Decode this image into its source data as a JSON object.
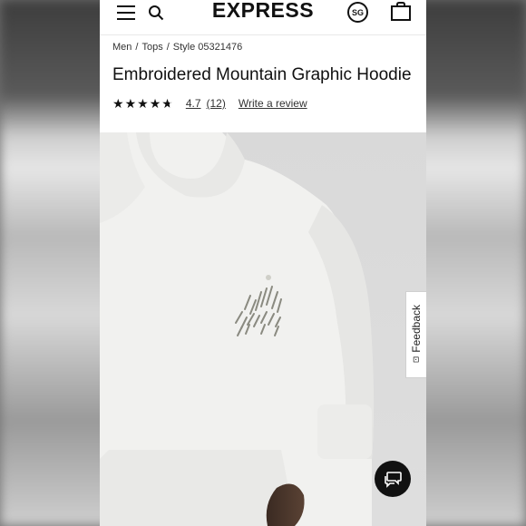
{
  "header": {
    "logo_text": "EXPRESS",
    "menu_icon": "hamburger-menu-icon",
    "search_icon": "search-icon",
    "region_badge": "SG",
    "bag_icon": "shopping-bag-icon"
  },
  "breadcrumb": {
    "items": [
      "Men",
      "Tops",
      "Style 05321476"
    ],
    "separator": "/"
  },
  "product": {
    "title": "Embroidered Mountain Graphic Hoodie",
    "rating": "4.7",
    "review_count": "(12)",
    "write_review_label": "Write a review",
    "stars": 4.7
  },
  "image": {
    "subject": "white hoodie with embroidered mountain graphic"
  },
  "feedback": {
    "label": "Feedback"
  },
  "chat": {
    "icon": "chat-bubbles-icon"
  },
  "colors": {
    "text": "#111111",
    "background": "#ffffff",
    "chat_button": "#111111"
  }
}
